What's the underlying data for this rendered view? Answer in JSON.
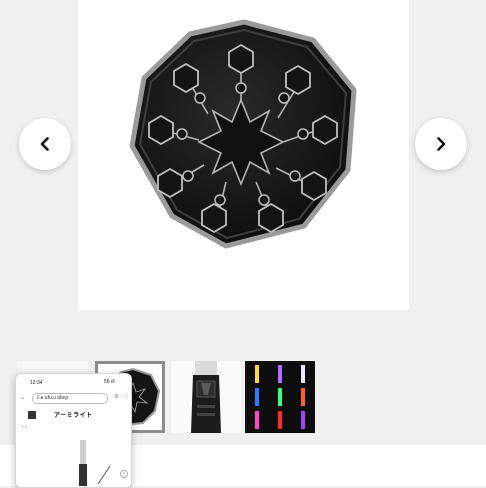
{
  "gallery": {
    "prev_icon": "chevron-left-icon",
    "next_icon": "chevron-right-icon",
    "thumbnails": [
      {
        "name": "thumb-phone-screenshot",
        "selected": false
      },
      {
        "name": "thumb-badge-closeup",
        "selected": true
      },
      {
        "name": "thumb-lightstick-grip",
        "selected": false
      },
      {
        "name": "thumb-color-variants",
        "selected": false
      }
    ]
  },
  "phone_preview": {
    "status_left": "12:34",
    "status_right": "56 ıll",
    "url": "ﾛ ▸ ufu.u  abcp",
    "tab_count": "3",
    "site_logo": "アーミライト"
  },
  "colors": {
    "page_bg": "#f0f0f0",
    "badge_metal": "#1a1a1a",
    "badge_rim": "#8e8e8e"
  }
}
